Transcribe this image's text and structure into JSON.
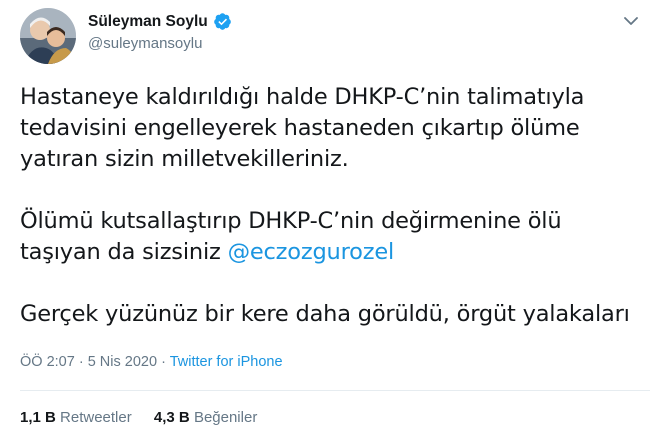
{
  "author": {
    "display_name": "Süleyman Soylu",
    "handle": "@suleymansoylu",
    "verified": true
  },
  "tweet": {
    "paragraphs": [
      [
        "Hastaneye kaldırıldığı halde DHKP-C’nin talimatıyla",
        "tedavisini engelleyerek hastaneden çıkartıp ölüme",
        "yatıran sizin milletvekilleriniz."
      ],
      [
        "Ölümü kutsallaştırıp DHKP-C’nin değirmenine ölü",
        "taşıyan da sizsiniz "
      ],
      [
        "Gerçek yüzünüz bir kere daha görüldü, örgüt yalakaları"
      ]
    ],
    "mention": "@eczozgurozel"
  },
  "meta": {
    "time": "ÖÖ 2:07",
    "separator1": "·",
    "date": "5 Nis 2020",
    "separator2": "·",
    "source": "Twitter for iPhone"
  },
  "stats": {
    "retweets_count": "1,1 B",
    "retweets_label": "Retweetler",
    "likes_count": "4,3 B",
    "likes_label": "Beğeniler"
  },
  "colors": {
    "link": "#1b95e0",
    "secondary_text": "#657786",
    "primary_text": "#14171a",
    "verified_badge": "#1da1f2",
    "divider": "#e6ecf0"
  },
  "icons": {
    "verified": "verified-badge-icon",
    "menu": "chevron-down-icon"
  }
}
